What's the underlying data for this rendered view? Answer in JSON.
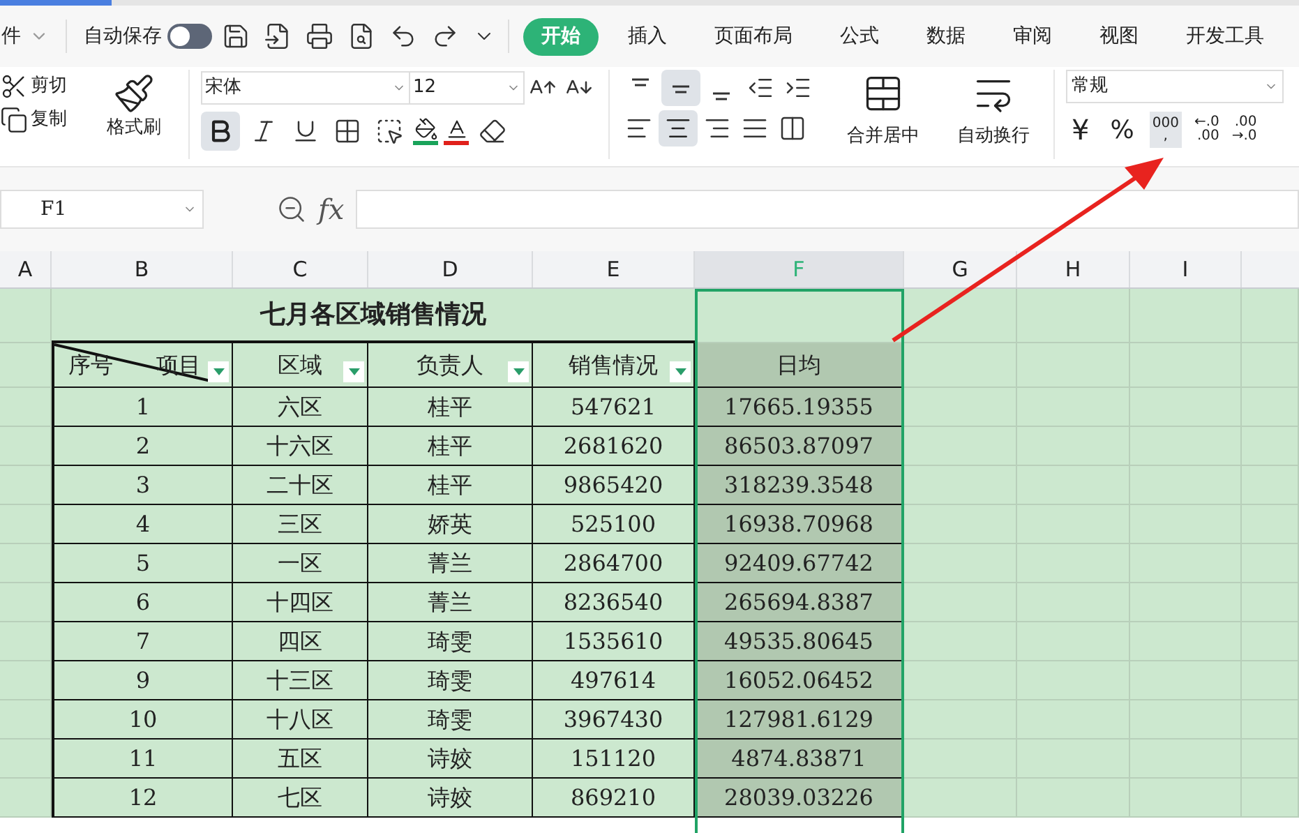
{
  "menu": {
    "file_label": "件",
    "autosave": {
      "label": "自动保存",
      "on": false
    },
    "tabs": [
      {
        "label": "开始",
        "selected": true
      },
      {
        "label": "插入",
        "selected": false
      },
      {
        "label": "页面布局",
        "selected": false
      },
      {
        "label": "公式",
        "selected": false
      },
      {
        "label": "数据",
        "selected": false
      },
      {
        "label": "审阅",
        "selected": false
      },
      {
        "label": "视图",
        "selected": false
      },
      {
        "label": "开发工具",
        "selected": false
      }
    ]
  },
  "ribbon": {
    "clipboard": {
      "cut": "剪切",
      "copy": "复制",
      "format_painter": "格式刷"
    },
    "font": {
      "name": "宋体",
      "size": "12",
      "bold_active": true
    },
    "alignment": {
      "middle_active": true,
      "center_active": true,
      "merge_center": "合并居中",
      "wrap_text": "自动换行"
    },
    "number": {
      "format": "常规",
      "currency": "¥",
      "percent": "%",
      "comma_style": "000",
      "comma_mark": ",",
      "comma_highlighted": true,
      "increase_decimal": [
        "←.0",
        ".00"
      ],
      "decrease_decimal": [
        ".00",
        "→.0"
      ]
    }
  },
  "formula_bar": {
    "cell": "F1",
    "fx": "fx"
  },
  "sheet": {
    "columns": [
      {
        "letter": "A",
        "selected": false
      },
      {
        "letter": "B",
        "selected": false
      },
      {
        "letter": "C",
        "selected": false
      },
      {
        "letter": "D",
        "selected": false
      },
      {
        "letter": "E",
        "selected": false
      },
      {
        "letter": "F",
        "selected": true
      },
      {
        "letter": "G",
        "selected": false
      },
      {
        "letter": "H",
        "selected": false
      },
      {
        "letter": "I",
        "selected": false
      }
    ],
    "title": "七月各区域销售情况",
    "headers": [
      {
        "kind": "diagonal",
        "labels": [
          "序号",
          "项目"
        ],
        "filter": true
      },
      {
        "kind": "plain",
        "labels": [
          "区域"
        ],
        "filter": true
      },
      {
        "kind": "plain",
        "labels": [
          "负责人"
        ],
        "filter": true
      },
      {
        "kind": "plain",
        "labels": [
          "销售情况"
        ],
        "filter": true
      },
      {
        "kind": "plain",
        "labels": [
          "日均"
        ],
        "filter": false
      }
    ],
    "rows": [
      [
        "",
        "1",
        "六区",
        "桂平",
        "547621",
        "17665.19355"
      ],
      [
        "",
        "2",
        "十六区",
        "桂平",
        "2681620",
        "86503.87097"
      ],
      [
        "",
        "3",
        "二十区",
        "桂平",
        "9865420",
        "318239.3548"
      ],
      [
        "",
        "4",
        "三区",
        "娇英",
        "525100",
        "16938.70968"
      ],
      [
        "",
        "5",
        "一区",
        "菁兰",
        "2864700",
        "92409.67742"
      ],
      [
        "",
        "6",
        "十四区",
        "菁兰",
        "8236540",
        "265694.8387"
      ],
      [
        "",
        "7",
        "四区",
        "琦雯",
        "1535610",
        "49535.80645"
      ],
      [
        "",
        "9",
        "十三区",
        "琦雯",
        "497614",
        "16052.06452"
      ],
      [
        "",
        "10",
        "十八区",
        "琦雯",
        "3967430",
        "127981.6129"
      ],
      [
        "",
        "11",
        "五区",
        "诗姣",
        "151120",
        "4874.83871"
      ],
      [
        "",
        "12",
        "七区",
        "诗姣",
        "869210",
        "28039.03226"
      ]
    ]
  }
}
